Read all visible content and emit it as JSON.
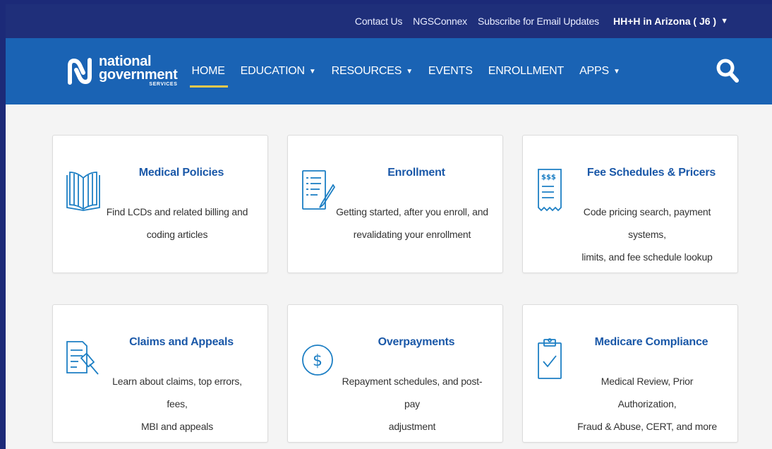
{
  "utility": {
    "links": [
      "Contact Us",
      "NGSConnex",
      "Subscribe for Email Updates"
    ],
    "region": "HH+H in Arizona ( J6 )"
  },
  "logo": {
    "line1": "national",
    "line2": "government",
    "line3": "SERVICES"
  },
  "nav": {
    "items": [
      {
        "label": "HOME",
        "dropdown": false,
        "active": true
      },
      {
        "label": "EDUCATION",
        "dropdown": true
      },
      {
        "label": "RESOURCES",
        "dropdown": true
      },
      {
        "label": "EVENTS",
        "dropdown": false
      },
      {
        "label": "ENROLLMENT",
        "dropdown": false
      },
      {
        "label": "APPS",
        "dropdown": true
      }
    ],
    "search_icon": "search-icon"
  },
  "cards": [
    {
      "title": "Medical Policies",
      "desc_line1": "Find LCDs and related billing and",
      "desc_line2": "coding articles",
      "icon": "book-icon"
    },
    {
      "title": "Enrollment",
      "desc_line1": "Getting started, after you enroll, and",
      "desc_line2": "revalidating your enrollment",
      "icon": "document-pen-icon"
    },
    {
      "title": "Fee Schedules & Pricers",
      "desc_line1": "Code pricing search, payment systems,",
      "desc_line2": "limits, and fee schedule lookup",
      "icon": "receipt-icon"
    },
    {
      "title": "Claims and Appeals",
      "desc_line1": "Learn about claims, top errors, fees,",
      "desc_line2": "MBI and appeals",
      "icon": "gavel-document-icon"
    },
    {
      "title": "Overpayments",
      "desc_line1": "Repayment schedules, and post-pay",
      "desc_line2": "adjustment",
      "icon": "dollar-circle-icon"
    },
    {
      "title": "Medicare Compliance",
      "desc_line1": "Medical Review, Prior Authorization,",
      "desc_line2": "Fraud & Abuse, CERT, and more",
      "icon": "clipboard-check-icon"
    }
  ],
  "colors": {
    "utility_bar": "#1f2f7a",
    "nav_bar": "#1a63b4",
    "active_underline": "#f2c94c",
    "card_title": "#1a58a8",
    "icon": "#1d7fc4"
  }
}
